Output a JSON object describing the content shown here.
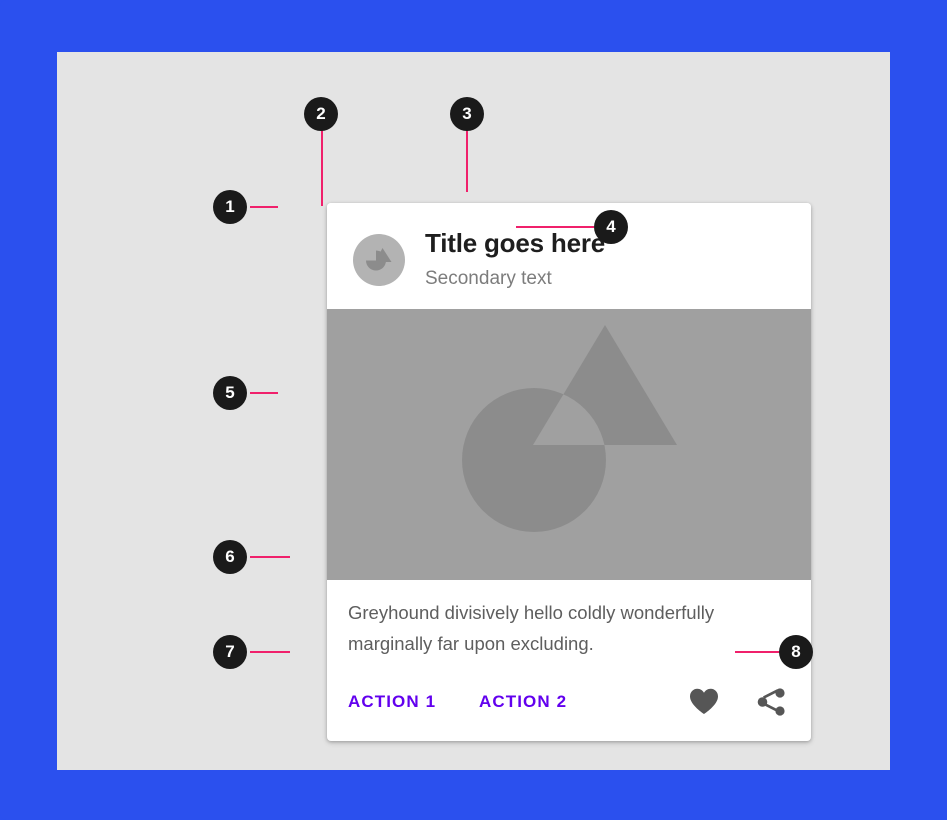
{
  "frame": {
    "border_color": "#2B50EE",
    "canvas_color": "#E4E4E4"
  },
  "card": {
    "background": "#FFFFFF",
    "header": {
      "avatar_icon": "media-placeholder-icon",
      "avatar_color": "#B3B3B3",
      "title": "Title goes here",
      "subtitle": "Secondary text"
    },
    "media": {
      "placeholder_icon": "image-placeholder-icon",
      "background": "#A0A0A0"
    },
    "body": {
      "supporting_text": "Greyhound divisively hello coldly wonderfully marginally far upon excluding."
    },
    "actions": {
      "accent_color": "#6200EE",
      "buttons": [
        {
          "label": "ACTION 1"
        },
        {
          "label": "ACTION 2"
        }
      ],
      "icons": [
        {
          "name": "favorite-icon",
          "glyph": "heart"
        },
        {
          "name": "share-icon",
          "glyph": "share"
        }
      ]
    }
  },
  "annotations": {
    "badge_color": "#1A1A1A",
    "leader_color": "#F0206B",
    "callouts": [
      {
        "number": "1",
        "target": "card-container"
      },
      {
        "number": "2",
        "target": "avatar"
      },
      {
        "number": "3",
        "target": "title"
      },
      {
        "number": "4",
        "target": "subtitle"
      },
      {
        "number": "5",
        "target": "media"
      },
      {
        "number": "6",
        "target": "supporting-text"
      },
      {
        "number": "7",
        "target": "action-buttons"
      },
      {
        "number": "8",
        "target": "action-icons"
      }
    ]
  }
}
